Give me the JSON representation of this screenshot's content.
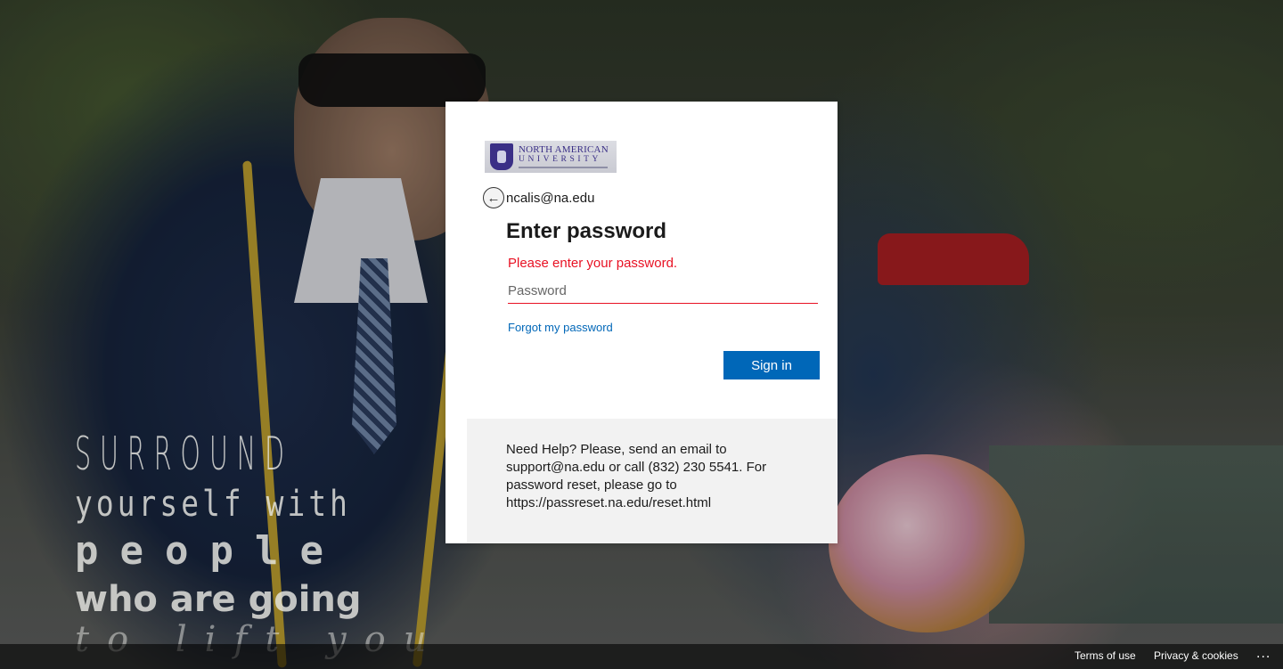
{
  "background": {
    "quote_lines": [
      "SURROUND",
      "yourself with",
      "people",
      "who are going",
      "to lift you"
    ]
  },
  "card": {
    "logo": {
      "line1": "NORTH AMERICAN",
      "line2": "UNIVERSITY"
    },
    "back_icon": "back-arrow-icon",
    "back_glyph": "←",
    "username": "ncalis@na.edu",
    "title": "Enter password",
    "error_message": "Please enter your password.",
    "password": {
      "placeholder": "Password",
      "value": ""
    },
    "forgot_link": "Forgot my password",
    "signin_label": "Sign in",
    "help_text": "Need Help? Please, send an email to support@na.edu or call (832) 230 5541. For password reset, please go to https://passreset.na.edu/reset.html"
  },
  "footer": {
    "terms": "Terms of use",
    "privacy": "Privacy & cookies",
    "more": "..."
  },
  "colors": {
    "accent": "#0067b8",
    "error": "#e81123",
    "help_bg": "#f2f2f2"
  }
}
